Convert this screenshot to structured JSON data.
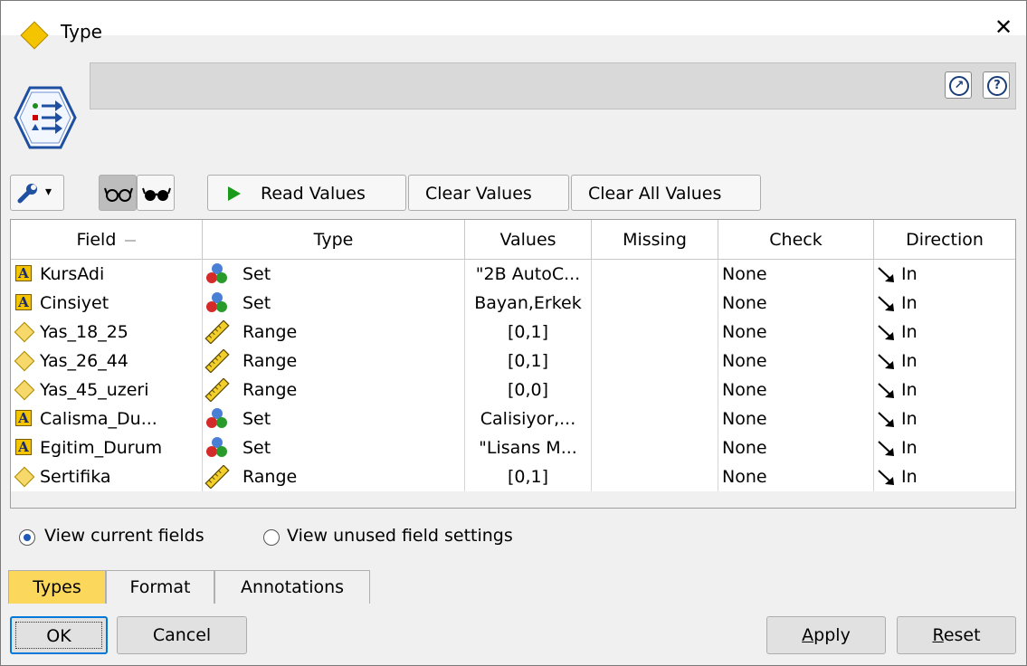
{
  "window": {
    "title": "Type",
    "close_glyph": "✕"
  },
  "header": {
    "node_icon": "type-node-icon",
    "buttons": [
      {
        "icon": "expand-arrow-icon",
        "glyph": "↗"
      },
      {
        "icon": "help-icon",
        "glyph": "?"
      }
    ]
  },
  "toolbar": {
    "tools_glyph": "▾",
    "read_values": "Read Values",
    "clear_values": "Clear Values",
    "clear_all_values": "Clear All Values"
  },
  "table": {
    "columns": [
      "Field",
      "Type",
      "Values",
      "Missing",
      "Check",
      "Direction"
    ],
    "rows": [
      {
        "field": "KursAdi",
        "field_icon": "text-A-icon",
        "type": "Set",
        "type_icon": "set-icon",
        "values": "\"2B AutoC...",
        "missing": "",
        "check": "None",
        "direction": "In"
      },
      {
        "field": "Cinsiyet",
        "field_icon": "text-A-icon",
        "type": "Set",
        "type_icon": "set-icon",
        "values": "Bayan,Erkek",
        "missing": "",
        "check": "None",
        "direction": "In"
      },
      {
        "field": "Yas_18_25",
        "field_icon": "numeric-diamond-icon",
        "type": "Range",
        "type_icon": "range-ruler-icon",
        "values": "[0,1]",
        "missing": "",
        "check": "None",
        "direction": "In"
      },
      {
        "field": "Yas_26_44",
        "field_icon": "numeric-diamond-icon",
        "type": "Range",
        "type_icon": "range-ruler-icon",
        "values": "[0,1]",
        "missing": "",
        "check": "None",
        "direction": "In"
      },
      {
        "field": "Yas_45_uzeri",
        "field_icon": "numeric-diamond-icon",
        "type": "Range",
        "type_icon": "range-ruler-icon",
        "values": "[0,0]",
        "missing": "",
        "check": "None",
        "direction": "In"
      },
      {
        "field": "Calisma_Du...",
        "field_icon": "text-A-icon",
        "type": "Set",
        "type_icon": "set-icon",
        "values": "Calisiyor,...",
        "missing": "",
        "check": "None",
        "direction": "In"
      },
      {
        "field": "Egitim_Durum",
        "field_icon": "text-A-icon",
        "type": "Set",
        "type_icon": "set-icon",
        "values": "\"Lisans M...",
        "missing": "",
        "check": "None",
        "direction": "In"
      },
      {
        "field": "Sertifika",
        "field_icon": "numeric-diamond-icon",
        "type": "Range",
        "type_icon": "range-ruler-icon",
        "values": "[0,1]",
        "missing": "",
        "check": "None",
        "direction": "In"
      }
    ]
  },
  "view_options": {
    "current": "View current fields",
    "unused": "View unused field settings",
    "selected": "current"
  },
  "tabs": [
    "Types",
    "Format",
    "Annotations"
  ],
  "active_tab": "Types",
  "buttons": {
    "ok": "OK",
    "cancel": "Cancel",
    "apply_u": "A",
    "apply_rest": "pply",
    "reset_u": "R",
    "reset_rest": "eset"
  },
  "colors": {
    "active_tab": "#fbd75b",
    "play_green": "#1a9a1a",
    "default_border": "#0078d7",
    "field_icon_yellow": "#f5c400"
  }
}
